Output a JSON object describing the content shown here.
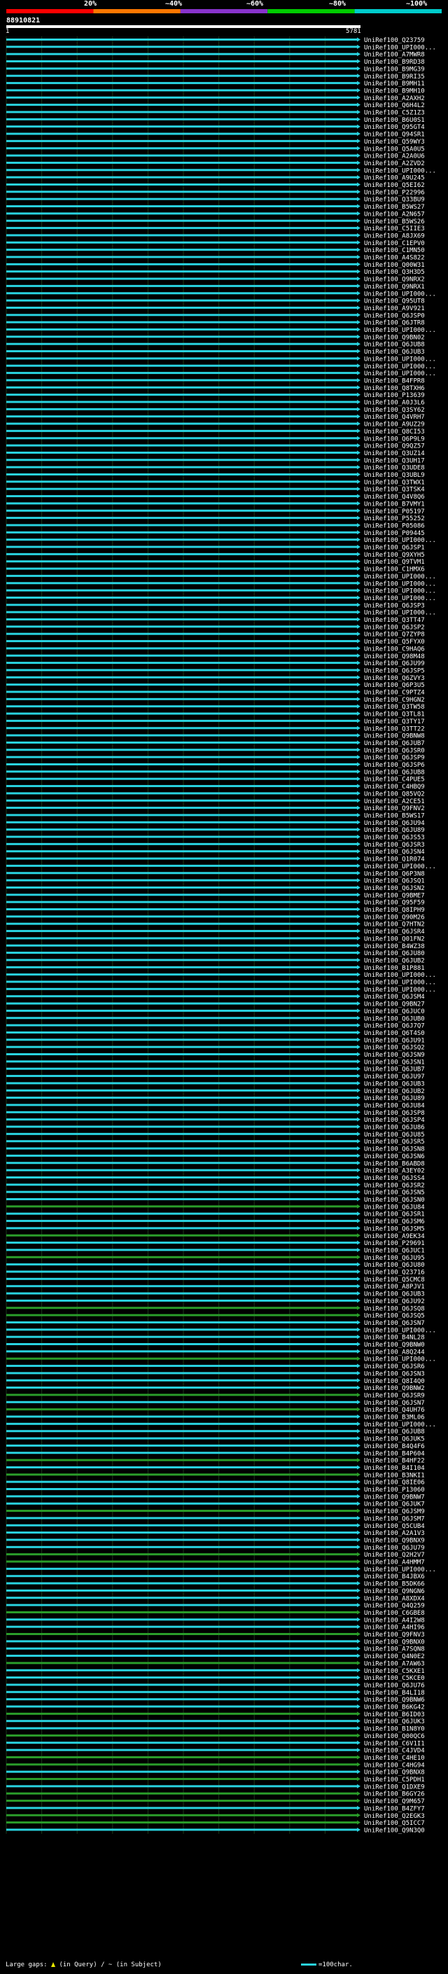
{
  "header": {
    "marks": [
      "20%",
      "~40%",
      "~60%",
      "~80%",
      "~100%"
    ],
    "colors": [
      "#ff0000",
      "#ff7700",
      "#8833cc",
      "#00cc00",
      "#00cccc"
    ]
  },
  "query_id": "88910821",
  "ruler": {
    "start": "1",
    "end": "5781"
  },
  "footer": {
    "left": "Large gaps:",
    "gap_query": "(in Query)",
    "sep": "/",
    "gap_subject": "~ (in Subject)",
    "right": "=100char."
  },
  "chart_data": {
    "type": "alignment",
    "query_length": 5781,
    "hits": [
      "UniRef100_Q23759",
      "UniRef100_UPI000...",
      "UniRef100_A7MWR8",
      "UniRef100_B9RD38",
      "UniRef100_B9MG39",
      "UniRef100_B9RI35",
      "UniRef100_B9MH11",
      "UniRef100_B9MH10",
      "UniRef100_A2AXH2",
      "UniRef100_Q6H4L2",
      "UniRef100_C5Z1Z3",
      "UniRef100_B6U0S1",
      "UniRef100_Q95GT4",
      "UniRef100_Q94SR1",
      "UniRef100_Q59WY3",
      "UniRef100_Q5A0U5",
      "UniRef100_A2A0U6",
      "UniRef100_A2ZVD2",
      "UniRef100_UPI000...",
      "UniRef100_A9U245",
      "UniRef100_Q5EI62",
      "UniRef100_P22996",
      "UniRef100_Q33BU9",
      "UniRef100_B5WS27",
      "UniRef100_A2N657",
      "UniRef100_B5WS26",
      "UniRef100_C5IIE3",
      "UniRef100_A8JX69",
      "UniRef100_C1EPV0",
      "UniRef100_C1MN50",
      "UniRef100_A4S822",
      "UniRef100_Q00W31",
      "UniRef100_Q3H3D5",
      "UniRef100_Q9NRX2",
      "UniRef100_Q9NRX1",
      "UniRef100_UPI000...",
      "UniRef100_Q95UT8",
      "UniRef100_A9V921",
      "UniRef100_Q6JSP0",
      "UniRef100_Q6JTR8",
      "UniRef100_UPI000...",
      "UniRef100_Q9BN02",
      "UniRef100_Q6JUB8",
      "UniRef100_Q6JUB3",
      "UniRef100_UPI000...",
      "UniRef100_UPI000...",
      "UniRef100_UPI000...",
      "UniRef100_B4FPR8",
      "UniRef100_Q8TXH6",
      "UniRef100_P13639",
      "UniRef100_A0J3L6",
      "UniRef100_Q3SY62",
      "UniRef100_Q4VRH7",
      "UniRef100_A9UZ29",
      "UniRef100_Q8CI53",
      "UniRef100_Q6P9L9",
      "UniRef100_Q9QZ57",
      "UniRef100_Q3UZ14",
      "UniRef100_Q3UH17",
      "UniRef100_Q3UDE8",
      "UniRef100_Q3UBL9",
      "UniRef100_Q3TWX1",
      "UniRef100_Q3TSK4",
      "UniRef100_Q4V8Q6",
      "UniRef100_B7VMY1",
      "UniRef100_P05197",
      "UniRef100_P55252",
      "UniRef100_P05086",
      "UniRef100_P09445",
      "UniRef100_UPI000...",
      "UniRef100_Q6JSP1",
      "UniRef100_Q9XYH5",
      "UniRef100_Q9TVM1",
      "UniRef100_C1HMX6",
      "UniRef100_UPI000...",
      "UniRef100_UPI000...",
      "UniRef100_UPI000...",
      "UniRef100_UPI000...",
      "UniRef100_Q6JSP3",
      "UniRef100_UPI000...",
      "UniRef100_Q3TT47",
      "UniRef100_Q6JSP2",
      "UniRef100_Q7ZYP8",
      "UniRef100_Q5FYX0",
      "UniRef100_C9HAQ6",
      "UniRef100_Q98M48",
      "UniRef100_Q6JU99",
      "UniRef100_Q6JSP5",
      "UniRef100_Q6ZVY3",
      "UniRef100_Q6P3U5",
      "UniRef100_C9PTZ4",
      "UniRef100_C9HGN2",
      "UniRef100_Q3TW58",
      "UniRef100_Q3TL81",
      "UniRef100_Q3TY17",
      "UniRef100_Q3TT22",
      "UniRef100_Q9BNW8",
      "UniRef100_Q6JUB7",
      "UniRef100_Q6JSR0",
      "UniRef100_Q6JSP9",
      "UniRef100_Q6JSP6",
      "UniRef100_Q6JUB8",
      "UniRef100_C4PUE5",
      "UniRef100_C4HBQ9",
      "UniRef100_Q85VQ2",
      "UniRef100_A2CE51",
      "UniRef100_Q9FNV2",
      "UniRef100_B5WS17",
      "UniRef100_Q6JU94",
      "UniRef100_Q6JU89",
      "UniRef100_Q6JS53",
      "UniRef100_Q6JSR3",
      "UniRef100_Q6JSN4",
      "UniRef100_Q1R074",
      "UniRef100_UPI000...",
      "UniRef100_Q6P3N8",
      "UniRef100_Q6JSQ1",
      "UniRef100_Q6JSN2",
      "UniRef100_Q9BME7",
      "UniRef100_Q95F59",
      "UniRef100_Q8IPH9",
      "UniRef100_Q90M26",
      "UniRef100_Q7HTN2",
      "UniRef100_Q6JSR4",
      "UniRef100_Q01FN2",
      "UniRef100_B4WZ38",
      "UniRef100_Q6JU80",
      "UniRef100_Q6JUB2",
      "UniRef100_B1P881",
      "UniRef100_UPI000...",
      "UniRef100_UPI000...",
      "UniRef100_UPI000...",
      "UniRef100_Q6JSM4",
      "UniRef100_Q9BN27",
      "UniRef100_Q6JUC0",
      "UniRef100_Q6JUB0",
      "UniRef100_Q6J7Q7",
      "UniRef100_Q6T4S0",
      "UniRef100_Q6JU91",
      "UniRef100_Q6JSQ2",
      "UniRef100_Q6JSN9",
      "UniRef100_Q6JSN1",
      "UniRef100_Q6JUB7",
      "UniRef100_Q6JU97",
      "UniRef100_Q6JUB3",
      "UniRef100_Q6JUB2",
      "UniRef100_Q6JU89",
      "UniRef100_Q6JU84",
      "UniRef100_Q6JSP8",
      "UniRef100_Q6JSP4",
      "UniRef100_Q6JU86",
      "UniRef100_Q6JU85",
      "UniRef100_Q6JSR5",
      "UniRef100_Q6JSN8",
      "UniRef100_Q6JSN6",
      "UniRef100_B6ABD8",
      "UniRef100_A3EY02",
      "UniRef100_Q6JSS4",
      "UniRef100_Q6JSR2",
      "UniRef100_Q6JSN5",
      "UniRef100_Q6JSN0",
      "UniRef100_Q6JU84",
      "UniRef100_Q6JSR1",
      "UniRef100_Q6JSM6",
      "UniRef100_Q6JSM5",
      "UniRef100_A9EK34",
      "UniRef100_P29691",
      "UniRef100_Q6JUC1",
      "UniRef100_Q6JU95",
      "UniRef100_Q6JU80",
      "UniRef100_Q23716",
      "UniRef100_Q5CMC8",
      "UniRef100_A8PJV1",
      "UniRef100_Q6JUB3",
      "UniRef100_Q6JU92",
      "UniRef100_Q6JSQ8",
      "UniRef100_Q6JSQ5",
      "UniRef100_Q6JSN7",
      "UniRef100_UPI000...",
      "UniRef100_B4NL28",
      "UniRef100_Q9BNW0",
      "UniRef100_A8Q244",
      "UniRef100_UPI000...",
      "UniRef100_Q6JSR6",
      "UniRef100_Q6JSN3",
      "UniRef100_Q8I4Q0",
      "UniRef100_Q9BNW2",
      "UniRef100_Q6JSR9",
      "UniRef100_Q6JSN7",
      "UniRef100_Q4UH76",
      "UniRef100_B3ML06",
      "UniRef100_UPI000...",
      "UniRef100_Q6JUB8",
      "UniRef100_Q6JUK5",
      "UniRef100_B4Q4F6",
      "UniRef100_B4P604",
      "UniRef100_B4HF22",
      "UniRef100_B4I104",
      "UniRef100_B3NKI1",
      "UniRef100_Q8IE06",
      "UniRef100_P13060",
      "UniRef100_Q9BNW7",
      "UniRef100_Q6JUK7",
      "UniRef100_Q6JSM9",
      "UniRef100_Q6JSM7",
      "UniRef100_Q5CUB4",
      "UniRef100_A2A1V3",
      "UniRef100_Q9BNX9",
      "UniRef100_Q6JU79",
      "UniRef100_Q2H2V7",
      "UniRef100_A4HMM7",
      "UniRef100_UPI000...",
      "UniRef100_B4JBX6",
      "UniRef100_B5DK66",
      "UniRef100_Q9NGN6",
      "UniRef100_A8XDX4",
      "UniRef100_Q4Q259",
      "UniRef100_C6GBE8",
      "UniRef100_A4I2W8",
      "UniRef100_A4HI96",
      "UniRef100_Q9FNV3",
      "UniRef100_Q9BNX0",
      "UniRef100_A7SQN8",
      "UniRef100_Q4N0E2",
      "UniRef100_A7AW63",
      "UniRef100_C5KXE1",
      "UniRef100_C5KCE0",
      "UniRef100_Q6JU76",
      "UniRef100_B4LI18",
      "UniRef100_Q9BNW6",
      "UniRef100_B6KG42",
      "UniRef100_B6ID03",
      "UniRef100_Q6JUK3",
      "UniRef100_B1N8Y0",
      "UniRef100_Q00QC6",
      "UniRef100_C6V1I1",
      "UniRef100_C4JVD4",
      "UniRef100_C4HE10",
      "UniRef100_C4HG94",
      "UniRef100_Q9BNX8",
      "UniRef100_C5PDH1",
      "UniRef100_Q1DXE9",
      "UniRef100_B6GY26",
      "UniRef100_Q9M657",
      "UniRef100_B4ZFY7",
      "UniRef100_Q2EGK3",
      "UniRef100_Q5ICC7",
      "UniRef100_Q9N3Q0"
    ],
    "color_key": "aqua = ~100% identity, green = ~80% identity",
    "axis": {
      "start": 1,
      "end": 5781
    }
  }
}
